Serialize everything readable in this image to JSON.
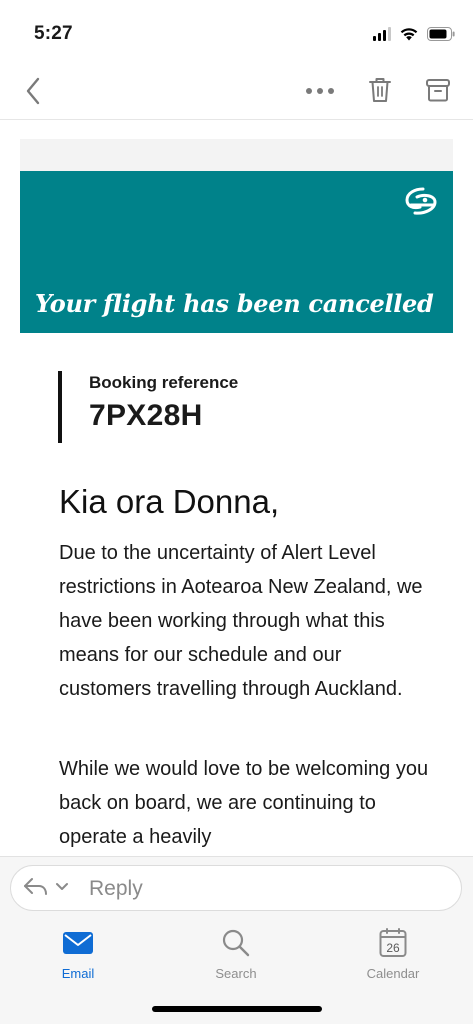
{
  "status_bar": {
    "time": "5:27"
  },
  "nav": {
    "back_icon": "chevron-left-icon",
    "more_icon": "more-horizontal-icon",
    "delete_icon": "trash-icon",
    "archive_icon": "archive-icon"
  },
  "email": {
    "banner": {
      "title": "Your flight has been cancelled",
      "background_color": "#00828a",
      "logo_icon": "koru-logo"
    },
    "booking_label": "Booking reference",
    "booking_code": "7PX28H",
    "greeting": "Kia ora Donna,",
    "paragraphs": [
      "Due to the uncertainty of Alert Level restrictions in Aotearoa New Zealand, we have been working through what this means for our schedule and our customers travelling through Auckland.",
      "While we would love to be welcoming you back on board, we are continuing to operate a heavily"
    ]
  },
  "reply": {
    "placeholder": "Reply",
    "icon": "reply-icon"
  },
  "tabs": [
    {
      "label": "Email",
      "icon": "mail-icon",
      "active": true
    },
    {
      "label": "Search",
      "icon": "search-icon",
      "active": false
    },
    {
      "label": "Calendar",
      "icon": "calendar-icon",
      "day": "26",
      "active": false
    }
  ],
  "colors": {
    "accent": "#0f6cd4",
    "banner": "#00828a"
  }
}
